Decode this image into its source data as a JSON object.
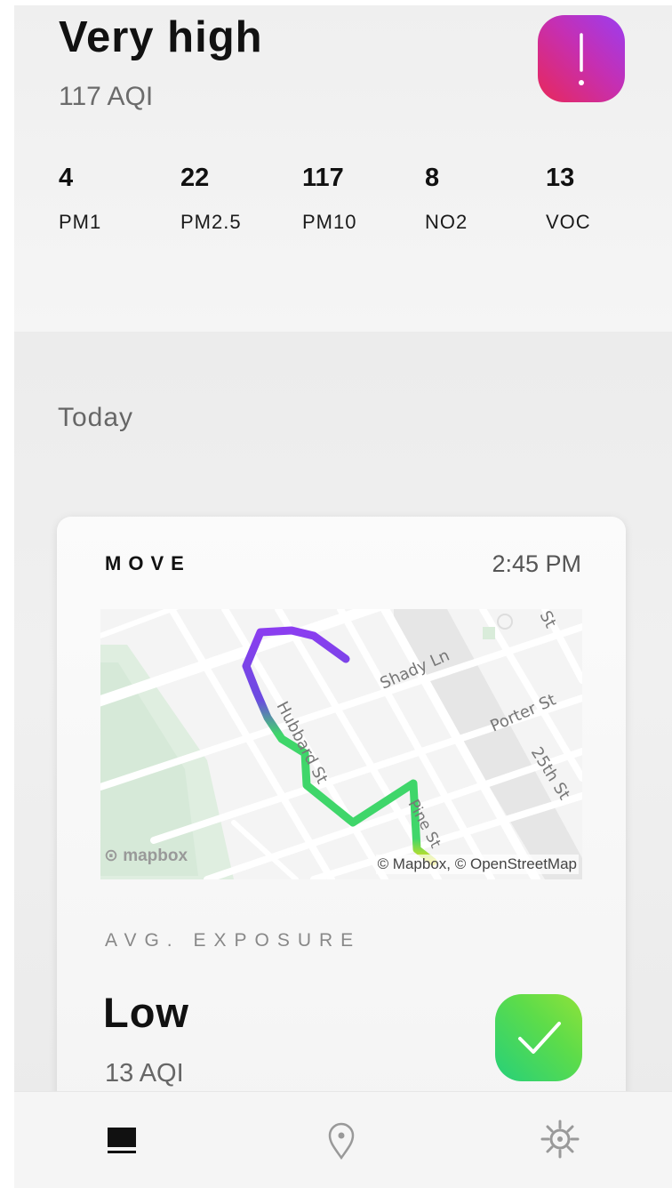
{
  "current": {
    "level": "Very high",
    "aqi": "117 AQI",
    "alert_icon": "exclamation-icon",
    "alert_color": "#c52fb3",
    "pollutants": [
      {
        "value": "4",
        "label": "PM1"
      },
      {
        "value": "22",
        "label": "PM2.5"
      },
      {
        "value": "117",
        "label": "PM10"
      },
      {
        "value": "8",
        "label": "NO2"
      },
      {
        "value": "13",
        "label": "VOC"
      }
    ]
  },
  "today": {
    "title": "Today",
    "card": {
      "type": "MOVE",
      "time": "2:45 PM",
      "map": {
        "labels": [
          "Shady Ln",
          "Porter St",
          "25th St",
          "Hubbard St",
          "Pine St",
          "St"
        ],
        "logo": "mapbox",
        "attribution": "© Mapbox, © OpenStreetMap"
      },
      "exposure_label": "AVG. EXPOSURE",
      "exposure_level": "Low",
      "exposure_aqi": "13 AQI",
      "check_icon": "checkmark-icon",
      "check_color": "#3fd65e"
    }
  },
  "tabs": [
    {
      "icon": "feed-icon",
      "active": true
    },
    {
      "icon": "map-pin-icon",
      "active": false
    },
    {
      "icon": "gear-icon",
      "active": false
    }
  ]
}
